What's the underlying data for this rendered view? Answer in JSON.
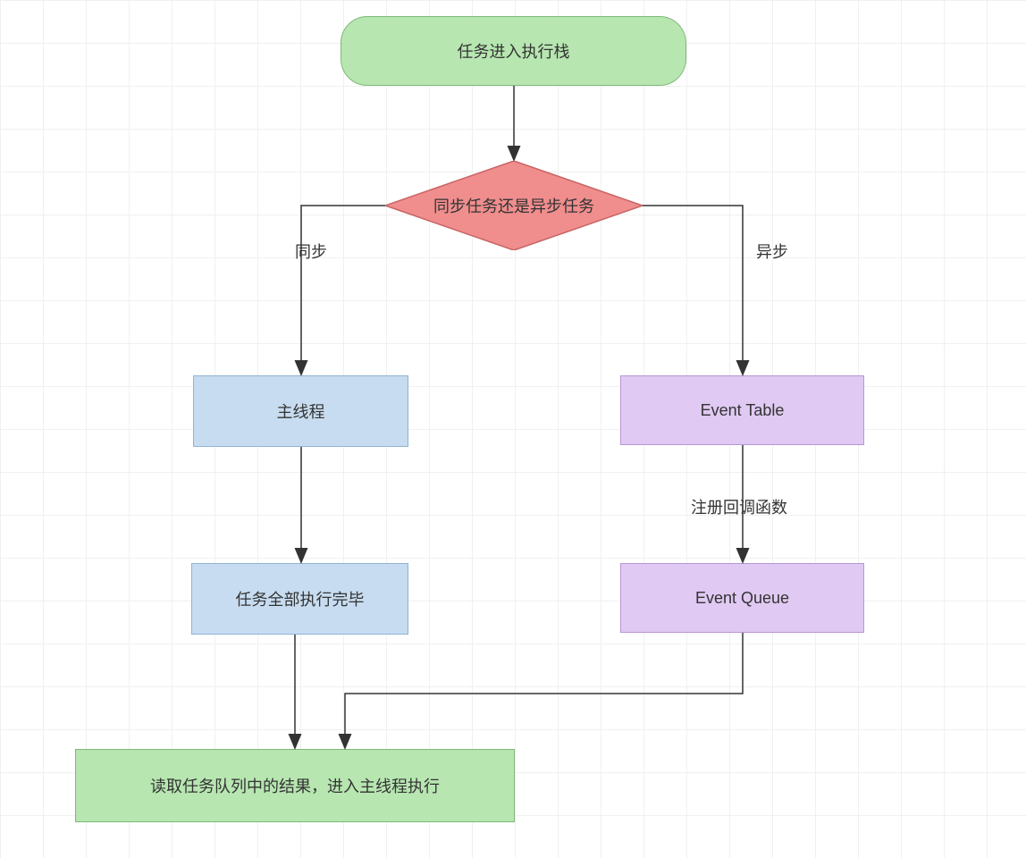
{
  "nodes": {
    "start": "任务进入执行栈",
    "decision": "同步任务还是异步任务",
    "main_thread": "主线程",
    "event_table": "Event Table",
    "all_done": "任务全部执行完毕",
    "event_queue": "Event Queue",
    "read_queue": "读取任务队列中的结果，进入主线程执行"
  },
  "edges": {
    "sync": "同步",
    "async": "异步",
    "register_callback": "注册回调函数"
  }
}
